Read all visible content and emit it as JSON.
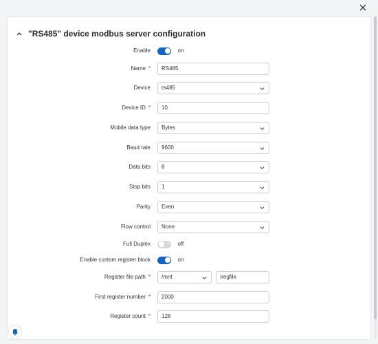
{
  "dialog": {
    "close_icon": "close-icon"
  },
  "panel": {
    "title": "\"RS485\" device modbus server configuration"
  },
  "colors": {
    "accent": "#1565c0",
    "required": "#e53935",
    "toggle_off": "#d7d9dc"
  },
  "fields": {
    "enable": {
      "label": "Enable",
      "state": "on"
    },
    "name": {
      "label": "Name",
      "value": "RS485"
    },
    "device": {
      "label": "Device",
      "value": "rs485"
    },
    "device_id": {
      "label": "Device ID",
      "value": "10"
    },
    "mobile_data_type": {
      "label": "Mobile data type",
      "value": "Bytes"
    },
    "baud_rate": {
      "label": "Baud rate",
      "value": "9600"
    },
    "data_bits": {
      "label": "Data bits",
      "value": "8"
    },
    "stop_bits": {
      "label": "Stop bits",
      "value": "1"
    },
    "parity": {
      "label": "Parity",
      "value": "Even"
    },
    "flow_control": {
      "label": "Flow control",
      "value": "None"
    },
    "full_duplex": {
      "label": "Full Duplex",
      "state": "off"
    },
    "custom_register": {
      "label": "Enable custom register block",
      "state": "on"
    },
    "register_file_path": {
      "label": "Register file path",
      "dir": "/mnt",
      "file": "/regfile"
    },
    "first_register": {
      "label": "First register number",
      "value": "2000"
    },
    "register_count": {
      "label": "Register count",
      "value": "128"
    }
  },
  "required_mark": "*",
  "icons": {
    "notifications": "bell-icon",
    "collapse": "chevron-up-icon",
    "dropdown": "chevron-down-icon"
  }
}
